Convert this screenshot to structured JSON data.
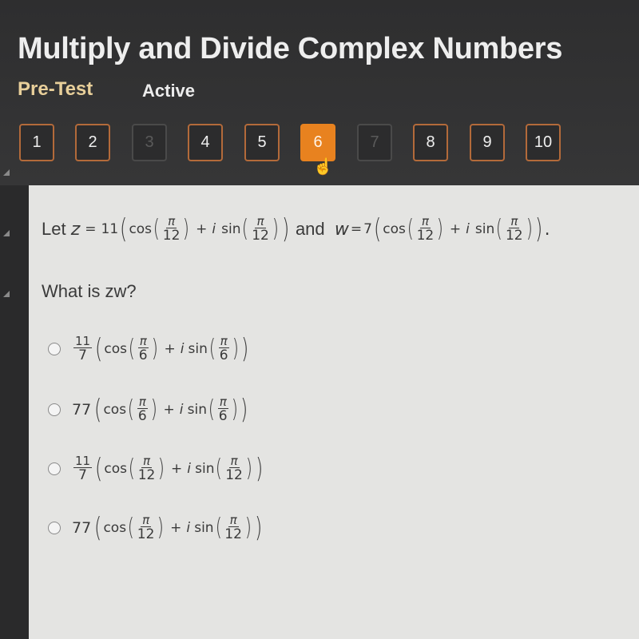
{
  "header": {
    "title": "Multiply and Divide Complex Numbers",
    "subtitle_type": "Pre-Test",
    "subtitle_status": "Active"
  },
  "question_nav": {
    "items": [
      {
        "label": "1",
        "state": "answered"
      },
      {
        "label": "2",
        "state": "answered"
      },
      {
        "label": "3",
        "state": "disabled"
      },
      {
        "label": "4",
        "state": "answered"
      },
      {
        "label": "5",
        "state": "answered"
      },
      {
        "label": "6",
        "state": "current"
      },
      {
        "label": "7",
        "state": "disabled"
      },
      {
        "label": "8",
        "state": "answered"
      },
      {
        "label": "9",
        "state": "answered"
      },
      {
        "label": "10",
        "state": "answered"
      }
    ],
    "accent_color": "#e8821f"
  },
  "question": {
    "prompt_start": "Let",
    "z_label": "z",
    "eq": "=",
    "z_modulus": "11",
    "cos": "cos",
    "sin": "sin",
    "i": "i",
    "plus": "+",
    "pi": "π",
    "z_angle_den": "12",
    "conj": "and",
    "w_label": "w",
    "w_modulus": "7",
    "w_angle_den": "12",
    "period": ".",
    "text": "What is zw?"
  },
  "options": [
    {
      "coef_num": "11",
      "coef_den": "7",
      "coef": "",
      "angle_den": "6"
    },
    {
      "coef_num": "",
      "coef_den": "",
      "coef": "77",
      "angle_den": "6"
    },
    {
      "coef_num": "11",
      "coef_den": "7",
      "coef": "",
      "angle_den": "12"
    },
    {
      "coef_num": "",
      "coef_den": "",
      "coef": "77",
      "angle_den": "12"
    }
  ]
}
